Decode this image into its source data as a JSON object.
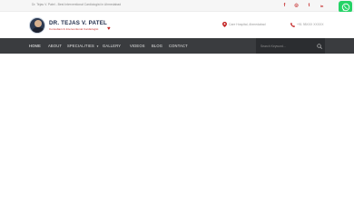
{
  "topbar": {
    "text": "Dr. Tejas V. Patel - Best Interventional Cardiologist in Ahmedabad"
  },
  "social": [
    {
      "icon": "facebook-icon",
      "glyph": "f"
    },
    {
      "icon": "instagram-icon",
      "glyph": "◎"
    },
    {
      "icon": "twitter-icon",
      "glyph": "t"
    },
    {
      "icon": "linkedin-icon",
      "glyph": "in"
    }
  ],
  "logo": {
    "name": "DR. TEJAS V. PATEL",
    "subtitle": "Consultant & Interventional Cardiologist"
  },
  "contact": {
    "address": "Care Hospital, Ahmedabad",
    "phone": "+91 98XXX XXXXX"
  },
  "nav": {
    "items": [
      {
        "label": "HOME"
      },
      {
        "label": "ABOUT"
      },
      {
        "label": "SPECIALITIES"
      },
      {
        "label": "GALLERY"
      },
      {
        "label": "VIDEOS"
      },
      {
        "label": "BLOG"
      },
      {
        "label": "CONTACT"
      }
    ]
  },
  "search": {
    "placeholder": "Search Keyword..."
  },
  "colors": {
    "accent": "#c52b2b",
    "nav_bg": "#3a3c3f",
    "whatsapp": "#25d366"
  }
}
